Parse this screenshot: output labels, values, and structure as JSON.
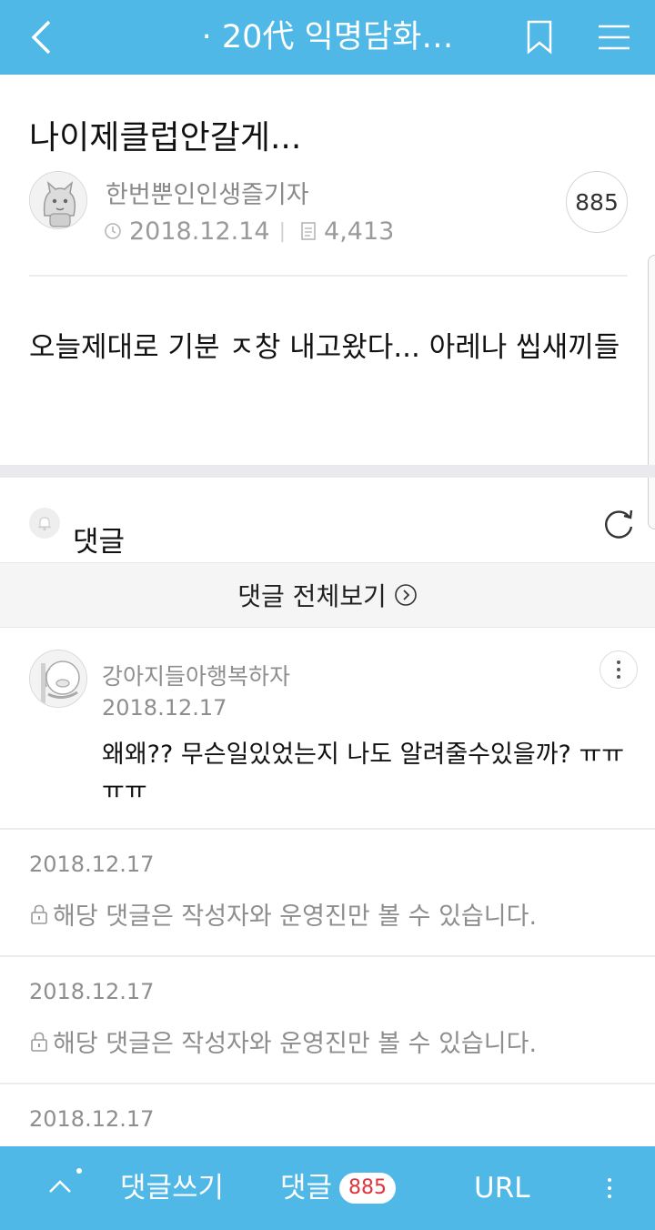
{
  "header": {
    "title": "· 20代 익명담화…",
    "back_icon": "chevron-left-icon",
    "bookmark_icon": "bookmark-icon",
    "menu_icon": "hamburger-icon",
    "bar_color": "#4fb8e6"
  },
  "post": {
    "title": "나이제클럽안갈게...",
    "author": "한번뿐인인생즐기자",
    "date": "2018.12.14",
    "views": "4,413",
    "comment_count": "885",
    "body": "오늘제대로 기분 ㅈ창 내고왔다... 아레나 씹새끼들"
  },
  "comments_section": {
    "label": "댓글",
    "view_all": "댓글 전체보기"
  },
  "comments": [
    {
      "author": "강아지들아행복하자",
      "date": "2018.12.17",
      "text": "왜왜?? 무슨일있었는지 나도 알려줄수있을까? ㅠㅠㅠㅠ"
    },
    {
      "date": "2018.12.17",
      "text": "해당 댓글은 작성자와 운영진만 볼 수 있습니다."
    },
    {
      "date": "2018.12.17",
      "text": "해당 댓글은 작성자와 운영진만 볼 수 있습니다."
    },
    {
      "date": "2018.12.17"
    }
  ],
  "bottom_bar": {
    "write_label": "댓글쓰기",
    "comments_label": "댓글",
    "comments_badge": "885",
    "url_label": "URL"
  }
}
